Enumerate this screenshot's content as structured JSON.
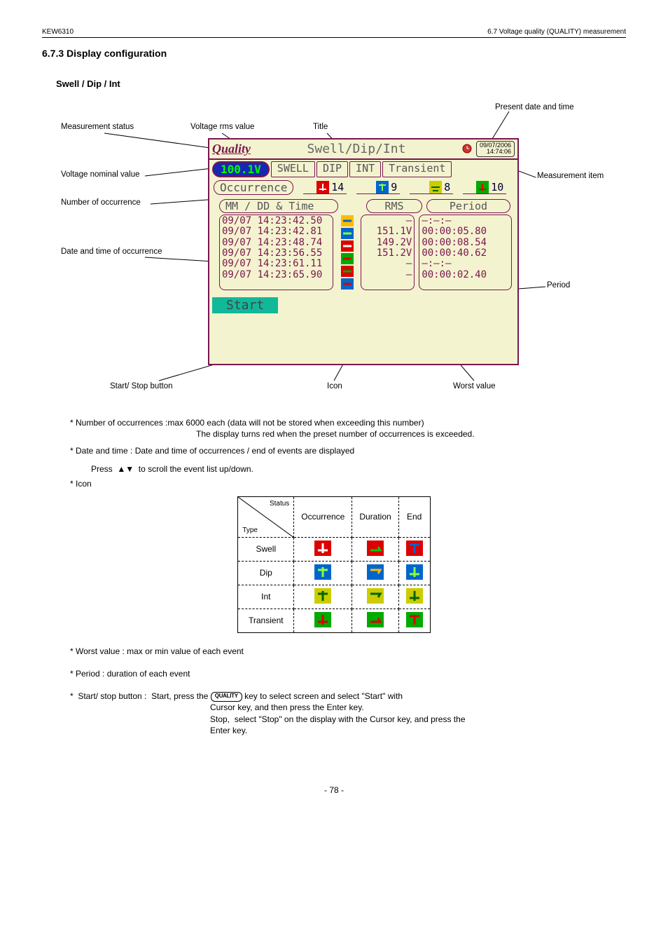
{
  "header": {
    "doc": "KEW6310",
    "section": "6.7 Voltage quality (QUALITY) measurement"
  },
  "sections": {
    "num_display": "6.7.3  Display configuration",
    "sub_swell": "Swell /  Dip / Int"
  },
  "callouts": {
    "meas_status": "Measurement status",
    "voltage": "Voltage rms value",
    "nominal": "Voltage nominal value",
    "num_occ": "Number of occurrence",
    "date_time": "Date and time of occurrence",
    "title": "Title",
    "present": "Present date and time",
    "meas_item": "Measurement item",
    "period": "Period",
    "worst": "Worst value",
    "icon": "Icon",
    "start": "Start/ Stop button"
  },
  "device": {
    "logo": "Quality",
    "title": "Swell/Dip/Int",
    "date": "09/07/2006",
    "time": "14:74:06",
    "vpill": "100.1V",
    "tabs": {
      "swell": "SWELL",
      "dip": "DIP",
      "int": "INT",
      "transient": "Transient"
    },
    "occ_label": "Occurrence",
    "occ_counts": {
      "swell": "14",
      "dip": "9",
      "int": "8",
      "transient": "10"
    },
    "headers": {
      "time": "MM / DD & Time",
      "rms": "RMS",
      "period": "Period"
    },
    "rows": [
      {
        "t": "09/07 14:23:42.50",
        "rms": "―",
        "period": "―:―:―"
      },
      {
        "t": "09/07 14:23:42.81",
        "rms": "151.1V",
        "period": "00:00:05.80"
      },
      {
        "t": "09/07 14:23:48.74",
        "rms": "149.2V",
        "period": "00:00:08.54"
      },
      {
        "t": "09/07 14:23:56.55",
        "rms": "151.2V",
        "period": "00:00:40.62"
      },
      {
        "t": "09/07 14:23:61.11",
        "rms": "―",
        "period": "―:―:―"
      },
      {
        "t": "09/07 14:23:65.90",
        "rms": "―",
        "period": "00:00:02.40"
      }
    ],
    "start": "Start"
  },
  "bullets": {
    "occ": "*  Number of occurrences  :max 6000 each (data will not be stored when exceeding this number)",
    "occ2": " The display turns red when the preset number of occurrences is exceeded.",
    "dt": "*  Date and time           : Date and time of occurrences / end of events are displayed",
    "updown": "Press               to scroll the event list up/down.",
    "icon": "*  Icon"
  },
  "legend": {
    "diag_top": "Status",
    "diag_bot": "Type",
    "st_occ": "Occurrence",
    "st_dur": "Duration",
    "st_end": "End",
    "row_swell": "Swell",
    "row_dip": "Dip",
    "row_int": "Int",
    "row_trans": "Transient"
  },
  "notes": {
    "worst": "*  Worst value    : max or min value of each event",
    "period": "*  Period           :  duration of each event",
    "startstop1": "*  Start/ stop button :  Start, press the         key to select screen and select \"Start\" with",
    "startstop2": "Cursor key, and then press the Enter key.",
    "startstop3": "Stop,  select \"Stop\" on the display with the Cursor key, and press the",
    "startstop4": "Enter key.",
    "quality_label": "QUALITY"
  },
  "footer": "- 78 -"
}
